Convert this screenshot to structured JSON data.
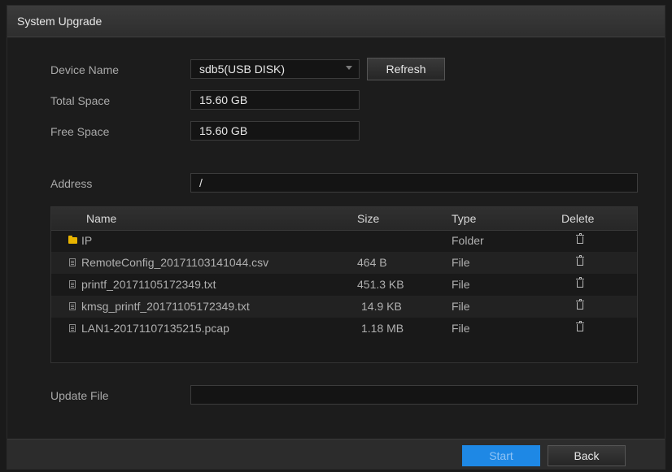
{
  "window": {
    "title": "System Upgrade"
  },
  "device": {
    "label": "Device Name",
    "value": "sdb5(USB DISK)",
    "refresh_label": "Refresh"
  },
  "total_space": {
    "label": "Total Space",
    "value": "15.60 GB"
  },
  "free_space": {
    "label": "Free Space",
    "value": "15.60 GB"
  },
  "address": {
    "label": "Address",
    "value": "/"
  },
  "table": {
    "headers": {
      "name": "Name",
      "size": "Size",
      "type": "Type",
      "delete": "Delete"
    },
    "rows": [
      {
        "name": "IP",
        "size": "",
        "type": "Folder",
        "icon": "folder-icon"
      },
      {
        "name": "RemoteConfig_20171103141044.csv",
        "size": "464 B",
        "type": "File",
        "icon": "file-icon"
      },
      {
        "name": "printf_20171105172349.txt",
        "size": "451.3 KB",
        "type": "File",
        "icon": "file-icon"
      },
      {
        "name": "kmsg_printf_20171105172349.txt",
        "size": "14.9 KB",
        "type": "File",
        "icon": "file-icon"
      },
      {
        "name": "LAN1-20171107135215.pcap",
        "size": "1.18 MB",
        "type": "File",
        "icon": "file-icon"
      }
    ]
  },
  "update_file": {
    "label": "Update File",
    "value": ""
  },
  "footer": {
    "start_label": "Start",
    "back_label": "Back"
  },
  "colors": {
    "accent": "#1e88e5",
    "background": "#1c1c1c"
  }
}
